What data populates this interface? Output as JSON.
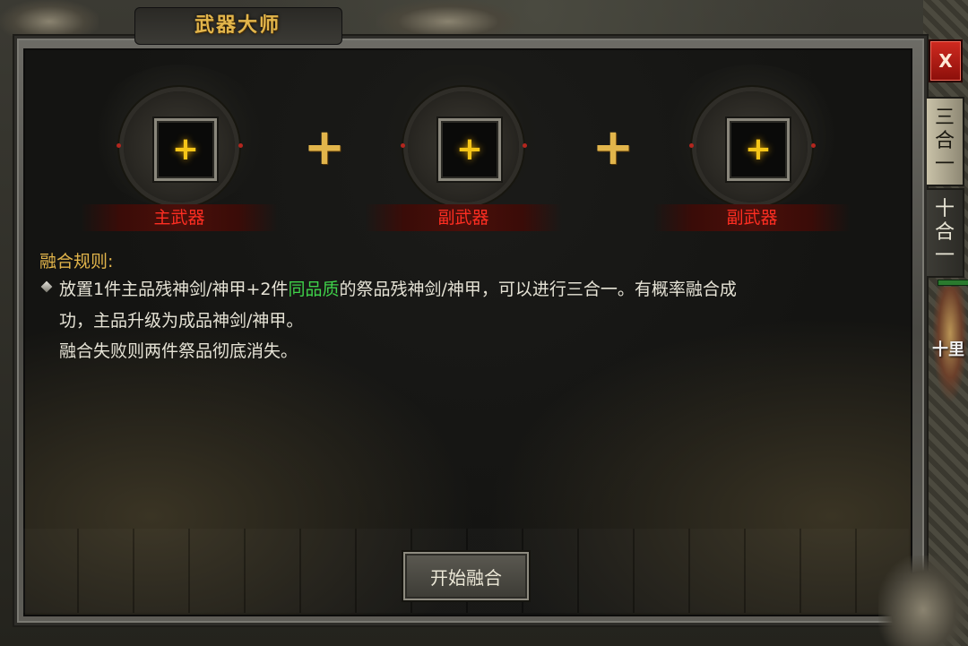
{
  "window": {
    "title": "武器大师",
    "close_label": "X"
  },
  "side_tabs": [
    {
      "chars": [
        "三",
        "合",
        "一"
      ],
      "active": true
    },
    {
      "chars": [
        "十",
        "合",
        "一"
      ],
      "active": false
    }
  ],
  "slots": [
    {
      "label": "主武器",
      "plus": "+"
    },
    {
      "label": "副武器",
      "plus": "+"
    },
    {
      "label": "副武器",
      "plus": "+"
    }
  ],
  "connector_plus": "+",
  "rules": {
    "title": "融合规则:",
    "line1_pre": "放置1件主品残神剑/神甲+2件",
    "line1_highlight": "同品质",
    "line1_post": "的祭品残神剑/神甲，可以进行三合一。有概率融合成",
    "line2": "功，主品升级为成品神剑/神甲。",
    "line3": "融合失败则两件祭品彻底消失。"
  },
  "start_button": "开始融合",
  "world": {
    "character_name_partial": "十里"
  },
  "colors": {
    "title_gold": "#e2b54b",
    "slot_label_red": "#ff2e22",
    "highlight_green": "#3fd24a",
    "plus_yellow": "#f5c518"
  }
}
